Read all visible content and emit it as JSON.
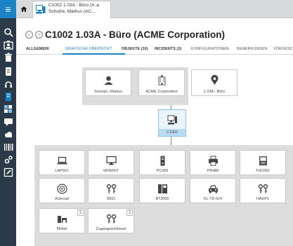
{
  "sidebar": {
    "menu_glyph": "≡",
    "icons": [
      "search-icon",
      "user-card-icon",
      "trash-icon",
      "document-icon",
      "headset-icon",
      "building-icon",
      "app-tiles-icon",
      "chat-icon",
      "cloud-icon",
      "barcode-icon",
      "settings-icon",
      "edit-box-icon"
    ]
  },
  "tab": {
    "title": "C1002 1.03A - Büro (A...",
    "subtitle": "Schulze, Markus (AC...",
    "close": "×"
  },
  "header": {
    "title": "C1002 1.03A - Büro (ACME Corporation)",
    "back": "‹",
    "forward": "›"
  },
  "subtabs": [
    {
      "label": "ALLGEMEIN",
      "bold": true
    },
    {
      "label": "GRAFISCHE ÜBERSICHT",
      "active": true
    },
    {
      "label": "OBJEKTE (16)",
      "bold": true
    },
    {
      "label": "INCIDENTS (2)",
      "bold": true
    },
    {
      "label": "KONFIGURATIONEN"
    },
    {
      "label": "BEMERKUNGEN"
    },
    {
      "label": "VORGESC"
    }
  ],
  "top_nodes": [
    {
      "label": "Schulze, Markus",
      "icon": "person-icon"
    },
    {
      "label": "ACME Corporation",
      "icon": "company-building-icon"
    },
    {
      "label": "1.03A - Büro",
      "icon": "location-pin-icon"
    }
  ],
  "center_node": {
    "label": "C1002",
    "icon": "workstation-icon"
  },
  "objects": [
    {
      "label": "LAP001",
      "icon": "laptop-icon"
    },
    {
      "label": "MON007",
      "icon": "monitor-icon"
    },
    {
      "label": "PC426",
      "icon": "pc-tower-icon"
    },
    {
      "label": "PR489",
      "icon": "printer-icon"
    },
    {
      "label": "THC001",
      "icon": "thin-client-icon"
    },
    {
      "label": "Autocad",
      "icon": "disc-icon"
    },
    {
      "label": "S001",
      "icon": "keys-icon"
    },
    {
      "label": "BT3000",
      "icon": "phone-icon"
    },
    {
      "label": "KL-TD 624",
      "icon": "car-icon"
    },
    {
      "label": "HAUP1",
      "icon": "keys-icon"
    },
    {
      "label": "Möbel",
      "icon": "furniture-icon",
      "badge": "2"
    },
    {
      "label": "Zugangsschlüssel",
      "icon": "keys-icon",
      "badge": "2"
    }
  ],
  "colors": {
    "accent": "#1b82c5",
    "sidebar": "#2b3a48",
    "panel": "#dcdcdc",
    "center_node": "#b9dbf3"
  }
}
